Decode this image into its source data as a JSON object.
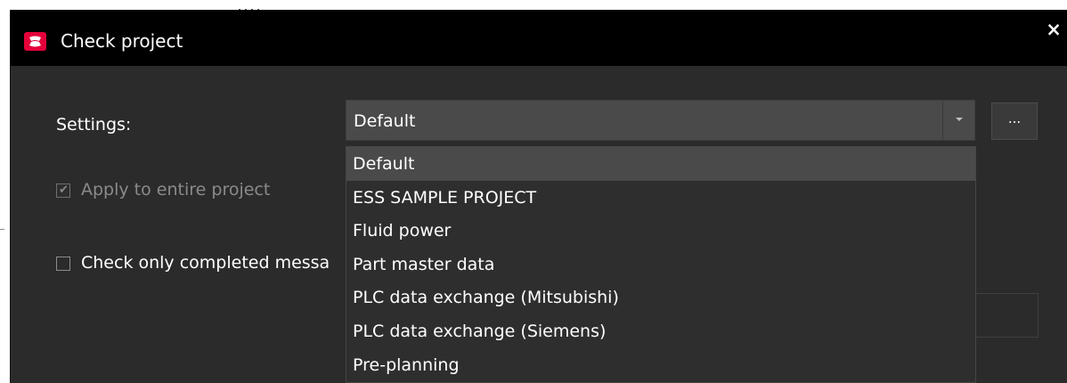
{
  "dialog": {
    "title": "Check project",
    "close_glyph": "×",
    "icon": "app-logo-icon",
    "accent_color": "#e4003a"
  },
  "settings": {
    "label": "Settings:",
    "selected": "Default",
    "more_button_label": "...",
    "options": [
      "Default",
      "ESS SAMPLE PROJECT",
      "Fluid power",
      "Part master data",
      "PLC data exchange (Mitsubishi)",
      "PLC data exchange (Siemens)",
      "Pre-planning"
    ]
  },
  "options": {
    "apply_entire_project": {
      "label": "Apply to entire project",
      "checked": true,
      "disabled": true
    },
    "check_only_completed": {
      "label": "Check only completed messa",
      "checked": false
    }
  }
}
